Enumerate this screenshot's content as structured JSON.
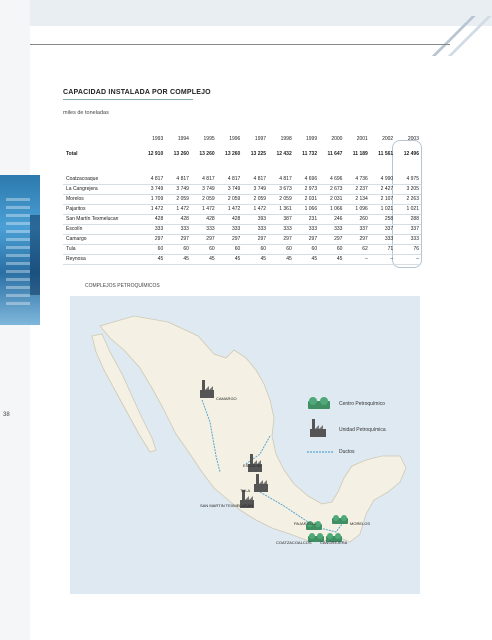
{
  "page": {
    "number": "38"
  },
  "report": {
    "title": "CAPACIDAD INSTALADA POR COMPLEJO",
    "units": "miles de toneladas"
  },
  "table": {
    "years": [
      "1993",
      "1994",
      "1995",
      "1996",
      "1997",
      "1998",
      "1999",
      "2000",
      "2001",
      "2002",
      "2003"
    ],
    "total": {
      "label": "Total",
      "values": [
        "12 910",
        "13 260",
        "13 260",
        "13 260",
        "13 225",
        "12 432",
        "11 732",
        "11 647",
        "11 189",
        "11 561",
        "12 496"
      ]
    },
    "rows": [
      {
        "name": "Coatzacoaque",
        "values": [
          "4 817",
          "4 817",
          "4 817",
          "4 817",
          "4 817",
          "4 817",
          "4 696",
          "4 696",
          "4 736",
          "4 990",
          "4 975"
        ]
      },
      {
        "name": "La Cangrejera",
        "values": [
          "3 749",
          "3 749",
          "3 749",
          "3 749",
          "3 749",
          "3 673",
          "2 973",
          "2 673",
          "2 237",
          "2 427",
          "3 205"
        ]
      },
      {
        "name": "Morelos",
        "values": [
          "1 709",
          "2 059",
          "2 059",
          "2 059",
          "2 059",
          "2 059",
          "2 031",
          "2 031",
          "2 134",
          "2 107",
          "2 263"
        ]
      },
      {
        "name": "Pajaritos",
        "values": [
          "1 472",
          "1 472",
          "1 472",
          "1 472",
          "1 472",
          "1 361",
          "1 066",
          "1 066",
          "1 096",
          "1 021",
          "1 021"
        ]
      },
      {
        "name": "San Martín Texmelucan",
        "values": [
          "428",
          "428",
          "428",
          "428",
          "393",
          "387",
          "231",
          "246",
          "260",
          "258",
          "288"
        ]
      },
      {
        "name": "Escolín",
        "values": [
          "333",
          "333",
          "333",
          "333",
          "333",
          "333",
          "333",
          "333",
          "337",
          "337",
          "337"
        ]
      },
      {
        "name": "Camargo",
        "values": [
          "297",
          "297",
          "297",
          "297",
          "297",
          "297",
          "297",
          "297",
          "297",
          "333",
          "333"
        ]
      },
      {
        "name": "Tula",
        "values": [
          "60",
          "60",
          "60",
          "60",
          "60",
          "60",
          "60",
          "60",
          "62",
          "71",
          "76"
        ]
      },
      {
        "name": "Reynosa",
        "values": [
          "45",
          "45",
          "45",
          "45",
          "45",
          "45",
          "45",
          "45",
          "–",
          "–",
          "–"
        ]
      }
    ]
  },
  "map": {
    "label": "COMPLEJOS PETROQUÍMICOS",
    "legend": {
      "centro": "Centro Petroquímico",
      "unidad": "Unidad Petroquímica",
      "ductos": "Ductos"
    },
    "cities": {
      "camargo": "CAMARGO",
      "escolin": "ESCOLIN",
      "tula": "TULA",
      "san_martin": "SAN MARTIN TEXMELUCAN",
      "pajaritos": "PAJARITOS",
      "morelos": "MORELOS",
      "coatzacoalcos": "COATZACOALCOS",
      "cangrejera": "CANGREJERA"
    },
    "colors": {
      "land": "#f4f1e4",
      "sea": "#dfe9f1",
      "centro": "#3f8f63",
      "unidad": "#555555",
      "ducto": "#5aa6cf"
    }
  }
}
